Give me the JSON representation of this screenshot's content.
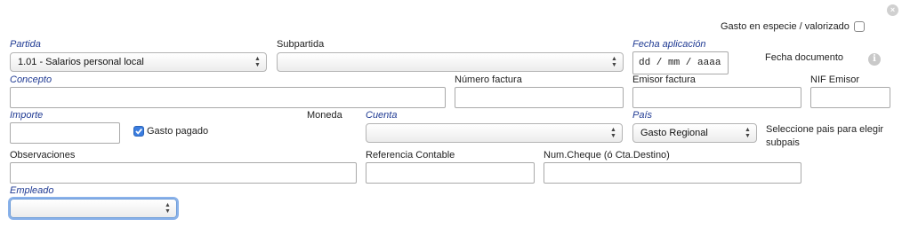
{
  "close_icon": "×",
  "info_icon": "i",
  "gasto_especie": {
    "label": "Gasto en especie / valorizado",
    "checked": false
  },
  "partida": {
    "label": "Partida",
    "value": "1.01 - Salarios personal local"
  },
  "subpartida": {
    "label": "Subpartida",
    "value": ""
  },
  "fecha_aplicacion": {
    "label": "Fecha aplicación",
    "placeholder": "dd / mm / aaaa"
  },
  "fecha_documento": {
    "label": "Fecha documento"
  },
  "concepto": {
    "label": "Concepto",
    "value": ""
  },
  "numero_factura": {
    "label": "Número factura",
    "value": ""
  },
  "emisor_factura": {
    "label": "Emisor factura",
    "value": ""
  },
  "nif_emisor": {
    "label": "NIF Emisor",
    "value": ""
  },
  "importe": {
    "label": "Importe",
    "value": ""
  },
  "gasto_pagado": {
    "label": "Gasto pagado",
    "checked": true
  },
  "moneda": {
    "label": "Moneda"
  },
  "cuenta": {
    "label": "Cuenta",
    "value": ""
  },
  "pais": {
    "label": "País",
    "value": "Gasto Regional",
    "hint": "Seleccione pais para elegir subpais"
  },
  "observaciones": {
    "label": "Observaciones",
    "value": ""
  },
  "referencia_contable": {
    "label": "Referencia Contable",
    "value": ""
  },
  "num_cheque": {
    "label": "Num.Cheque (ó Cta.Destino)",
    "value": ""
  },
  "empleado": {
    "label": "Empleado",
    "value": ""
  }
}
